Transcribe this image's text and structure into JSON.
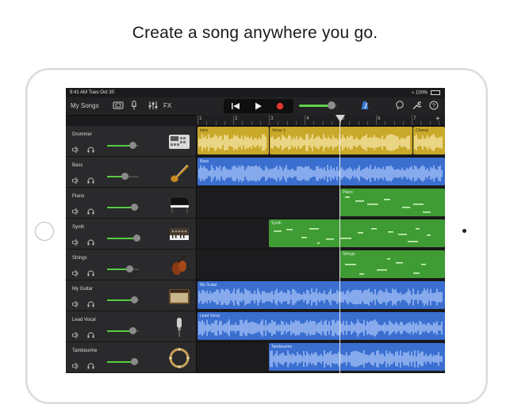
{
  "headline": "Create a song anywhere you go.",
  "status": {
    "time": "9:41 AM  Tues Oct 30",
    "battery": "100%"
  },
  "toolbar": {
    "my_songs": "My Songs",
    "fx": "FX"
  },
  "ruler": {
    "bars": [
      "1",
      "2",
      "3",
      "4",
      "5",
      "6",
      "7"
    ]
  },
  "tracks": [
    {
      "name": "Drummer",
      "volume": 0.8
    },
    {
      "name": "Bass",
      "volume": 0.55
    },
    {
      "name": "Piano",
      "volume": 0.85
    },
    {
      "name": "Synth",
      "volume": 0.92
    },
    {
      "name": "Strings",
      "volume": 0.7
    },
    {
      "name": "My Guitar",
      "volume": 0.85
    },
    {
      "name": "Lead Vocal",
      "volume": 0.8
    },
    {
      "name": "Tambourine",
      "volume": 0.85
    }
  ],
  "regions": {
    "drummer": [
      "Intro",
      "Verse 1",
      "Chorus"
    ],
    "bass": "Bass",
    "piano": "Piano",
    "synth": "Synth",
    "strings": "Strings",
    "guitar": "My Guitar",
    "vocal": "Lead Vocal",
    "tambourine": "Tambourine"
  },
  "colors": {
    "drummer": "#c9a82a",
    "audio": "#3a6fd0",
    "midi": "#3f9b33",
    "accent": "#57cc43"
  }
}
